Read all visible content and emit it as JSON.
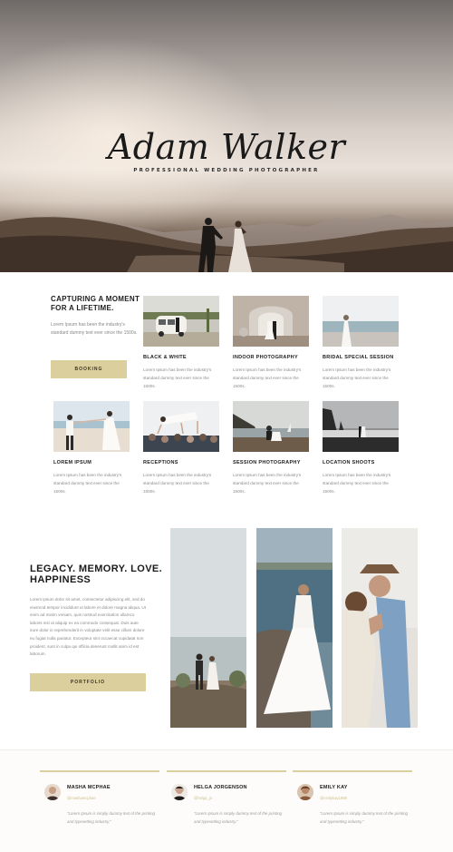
{
  "hero": {
    "title": "Adam Walker",
    "subtitle": "PROFESSIONAL WEDDING PHOTOGRAPHER"
  },
  "intro": {
    "title": "CAPTURING A MOMENT FOR A LIFETIME.",
    "text": "Lorem Ipsum has been the industry's standard dummy text ever since the 1500s.",
    "button_label": "BOOKING"
  },
  "services": [
    {
      "title": "BLACK & WHITE",
      "text": "Lorem Ipsum has been the industry's standard dummy text ever since the 1500s."
    },
    {
      "title": "INDOOR PHOTOGRAPHY",
      "text": "Lorem Ipsum has been the industry's standard dummy text ever since the 1500s."
    },
    {
      "title": "BRIDAL SPECIAL SESSION",
      "text": "Lorem Ipsum has been the industry's standard dummy text ever since the 1500s."
    },
    {
      "title": "LOREM IPSUM",
      "text": "Lorem Ipsum has been the industry's standard dummy text ever since the 1500s."
    },
    {
      "title": "RECEPTIONS",
      "text": "Lorem Ipsum has been the industry's standard dummy text ever since the 1500s."
    },
    {
      "title": "SESSION PHOTOGRAPHY",
      "text": "Lorem Ipsum has been the industry's standard dummy text ever since the 1500s."
    },
    {
      "title": "LOCATION SHOOTS",
      "text": "Lorem Ipsum has been the industry's standard dummy text ever since the 1500s."
    }
  ],
  "legacy": {
    "title": "LEGACY. MEMORY. LOVE. HAPPINESS",
    "text": "Lorem ipsum dolor sit amet, consectetur adipiscing elit, sed do eiusmod tempor incididunt ut labore et dolore magna aliqua. Ut enim ad minim veniam, quis nostrud exercitation ullamco laboris nisi ut aliquip ex ea commodo consequat. Duis aute irure dolor in reprehenderit in voluptate velit esse cillum dolore eu fugiat nulla pariatur. Excepteur sint occaecat cupidatat non proident, sunt in culpa qui officia deserunt mollit anim id est laborum.",
    "button_label": "PORTFOLIO"
  },
  "testimonials": [
    {
      "name": "MASHA MCPHAE",
      "handle": "@mashamcphae",
      "quote": "\"Lorem Ipsum is simply dummy text of the printing and typesetting industry.\""
    },
    {
      "name": "HELGA JORGENSON",
      "handle": "@helga_jo",
      "quote": "\"Lorem Ipsum is simply dummy text of the printing and typesetting industry.\""
    },
    {
      "name": "EMILY KAY",
      "handle": "@emilykay1988",
      "quote": "\"Lorem Ipsum is simply dummy text of the printing and typesetting industry.\""
    }
  ],
  "colors": {
    "accent": "#dccf9e",
    "text_dark": "#1d1d1d",
    "text_muted": "#8a8a8a"
  }
}
